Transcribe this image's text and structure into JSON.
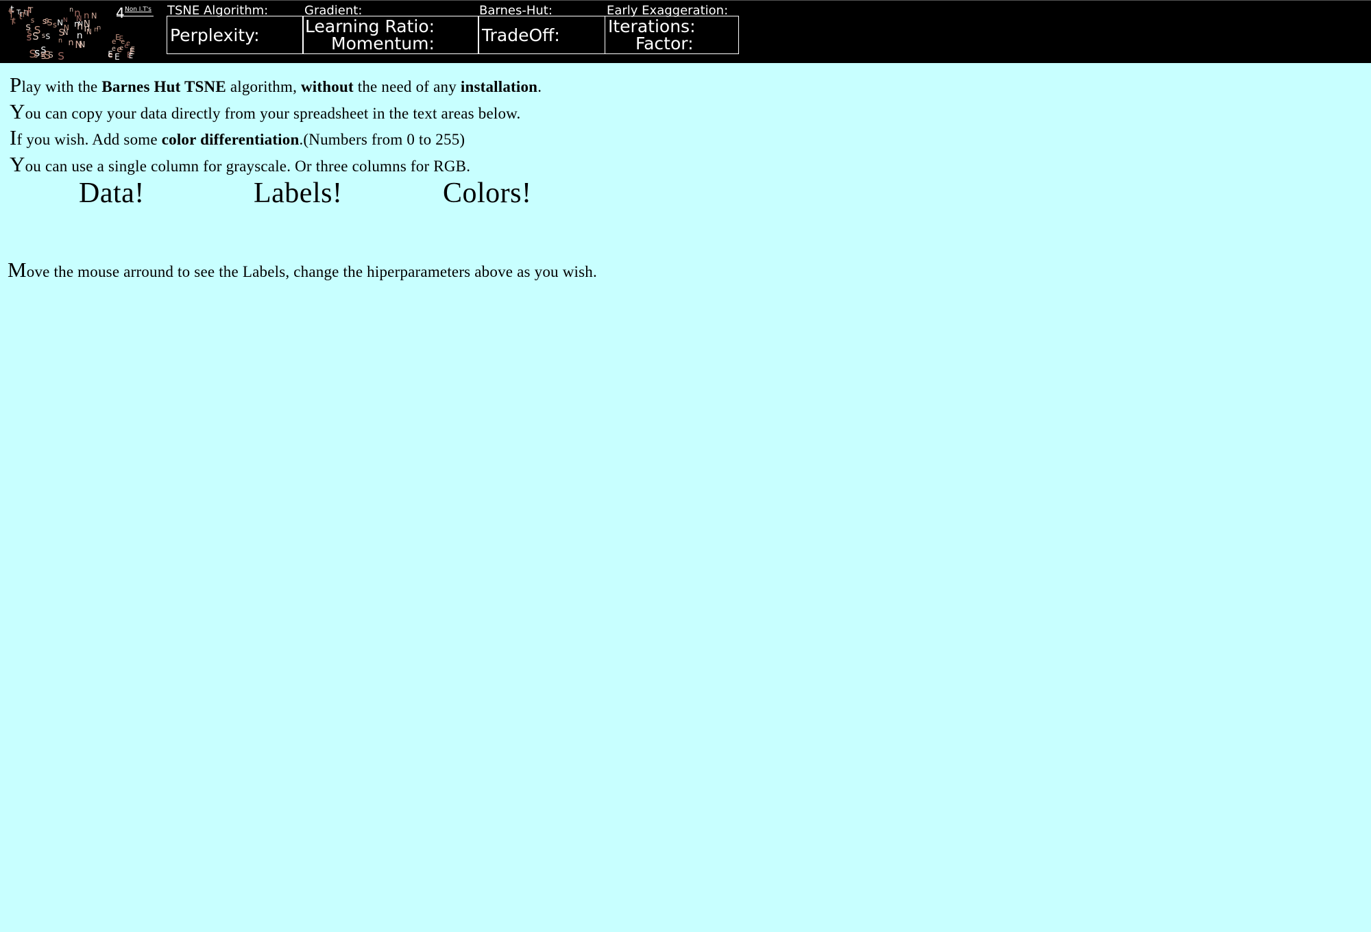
{
  "header": {
    "logo": {
      "suffix": "4",
      "subtitle": "Non I.T's"
    },
    "groups": [
      {
        "title": "TSNE Algorithm:",
        "params": [
          {
            "label": "Perplexity:"
          }
        ]
      },
      {
        "title": "Gradient:",
        "params": [
          {
            "label": "Learning Ratio:"
          },
          {
            "label": "Momentum:"
          }
        ]
      },
      {
        "title": "Barnes-Hut:",
        "params": [
          {
            "label": "TradeOff:"
          }
        ]
      },
      {
        "title": "Early Exaggeration:",
        "params": [
          {
            "label": "Iterations:"
          },
          {
            "label": "Factor:"
          }
        ]
      }
    ]
  },
  "intro": {
    "line1": {
      "cap": "P",
      "t1": "lay with the ",
      "b1": "Barnes Hut TSNE",
      "t2": " algorithm, ",
      "b2": "without",
      "t3": " the need of any ",
      "b3": "installation",
      "t4": "."
    },
    "line2": {
      "cap": "Y",
      "t1": "ou can copy your data directly from your spreadsheet in the text areas below."
    },
    "line3": {
      "cap": "I",
      "t1": "f you wish. Add some ",
      "b1": "color differentiation",
      "t2": ".(Numbers from 0 to 255)"
    },
    "line4": {
      "cap": "Y",
      "t1": "ou can use a single column for grayscale. Or three columns for RGB."
    }
  },
  "sections": {
    "data_title": "Data!",
    "labels_title": "Labels!",
    "colors_title": "Colors!"
  },
  "footer": {
    "cap": "M",
    "text": "ove the mouse arround to see the Labels, change the hiperparameters above as you wish."
  },
  "colors": {
    "background": "#c8ffff",
    "topbar": "#000000",
    "logo_letters": [
      "#c99a86",
      "#b07a6a",
      "#d8b0a0",
      "#a06a62",
      "#e0c8bc",
      "#ffffff"
    ]
  }
}
